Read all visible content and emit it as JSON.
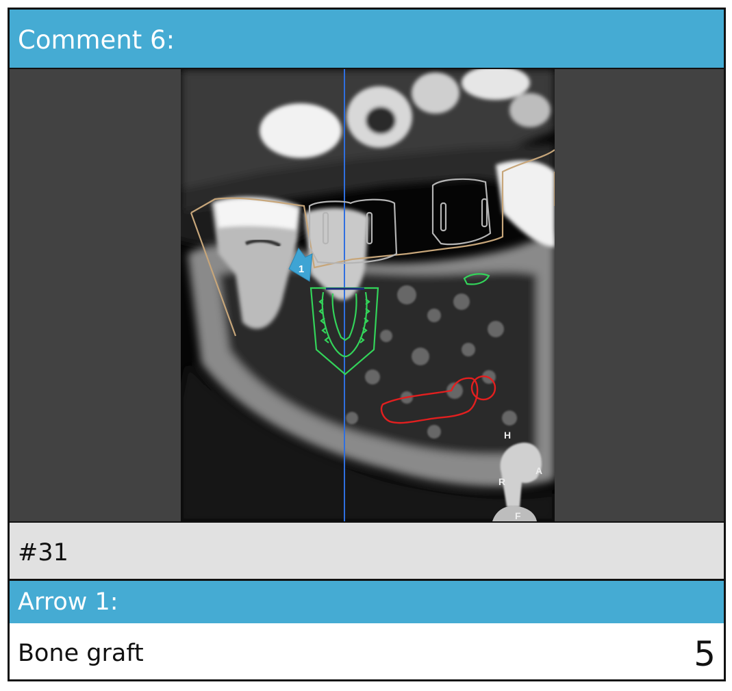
{
  "header": {
    "title": "Comment 6:"
  },
  "image": {
    "arrow_number": "1",
    "orientation": {
      "top": "H",
      "front": "A",
      "right": "R",
      "bottom": "F"
    },
    "colors": {
      "implant": "#33d45a",
      "nerve": "#e31f1f",
      "crown_outline": "#c7a67a",
      "reference_line": "#2f6fe0",
      "arrow": "#3ea4d4"
    }
  },
  "tooth_label": "#31",
  "arrow_section": {
    "title": "Arrow 1:",
    "text": "Bone graft"
  },
  "page_number": "5"
}
